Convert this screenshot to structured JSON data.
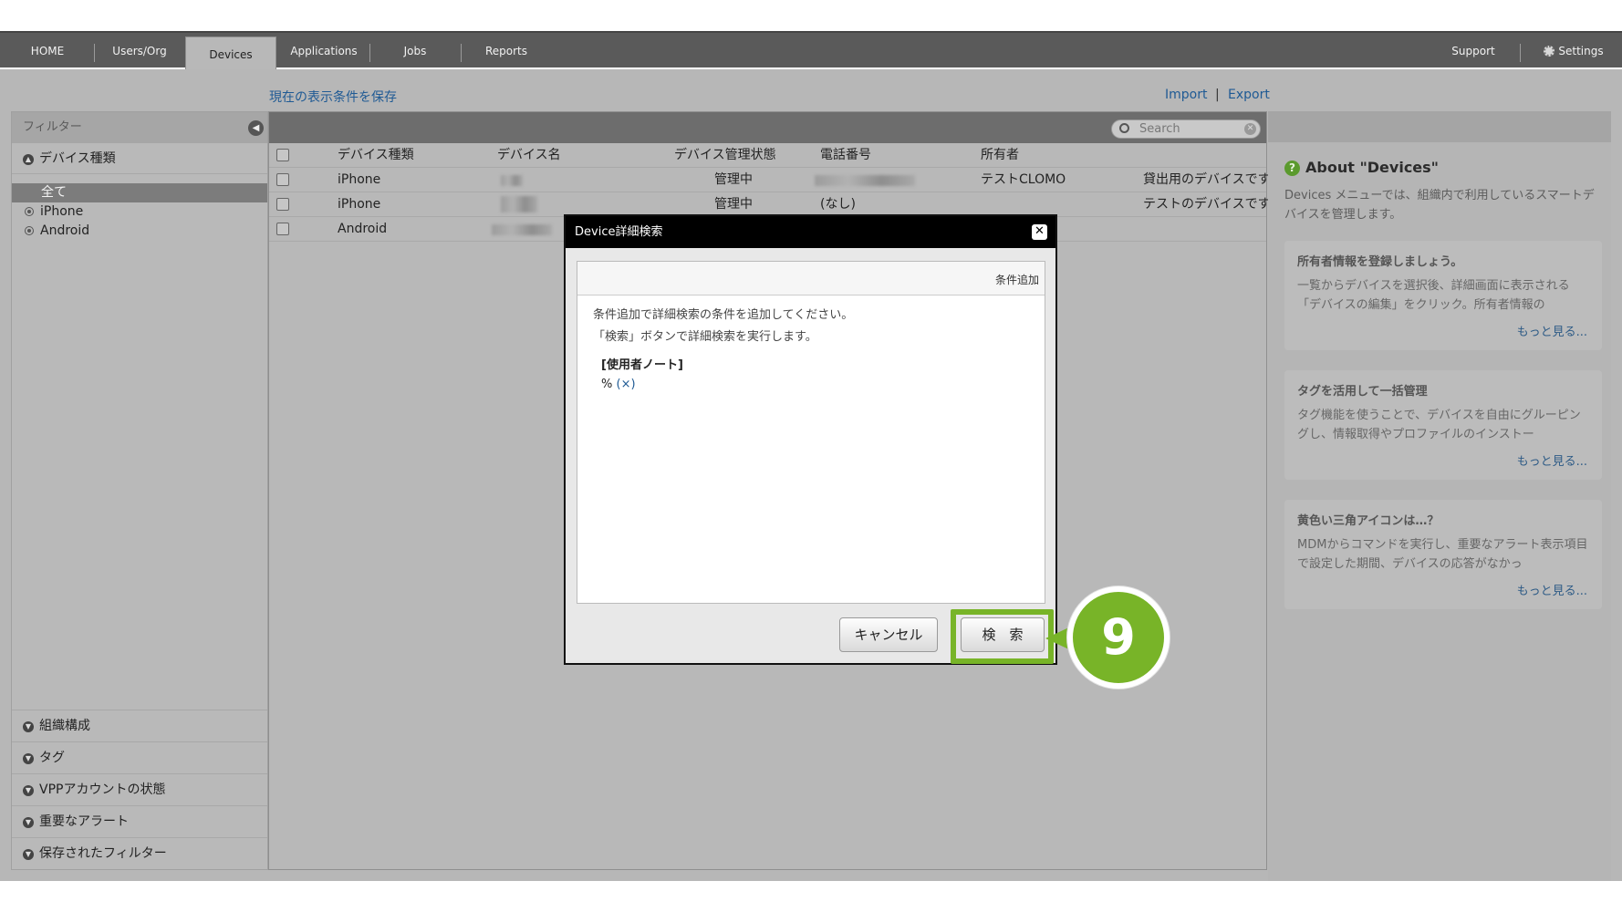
{
  "nav": {
    "home": "HOME",
    "users": "Users/Org",
    "devices": "Devices",
    "applications": "Applications",
    "jobs": "Jobs",
    "reports": "Reports",
    "support": "Support",
    "settings": "Settings"
  },
  "toolbar": {
    "save_view": "現在の表示条件を保存",
    "import": "Import",
    "separator": "|",
    "export": "Export"
  },
  "filter": {
    "title": "フィルター",
    "device_type": "デバイス種類",
    "items": [
      "全て",
      "iPhone",
      "Android"
    ],
    "sections": [
      "組織構成",
      "タグ",
      "VPPアカウントの状態",
      "重要なアラート",
      "保存されたフィルター"
    ]
  },
  "search": {
    "placeholder": "Search"
  },
  "table": {
    "headers": [
      "デバイス種類",
      "デバイス名",
      "デバイス管理状態",
      "電話番号",
      "所有者"
    ],
    "rows": [
      {
        "type": "iPhone",
        "status": "管理中",
        "phone": "",
        "owner": "テストCLOMO",
        "note": "貸出用のデバイスです"
      },
      {
        "type": "iPhone",
        "status": "管理中",
        "phone": "(なし)",
        "owner": "",
        "note": "テストのデバイスです"
      },
      {
        "type": "Android",
        "status": "",
        "phone": "",
        "owner": "",
        "note": ""
      }
    ]
  },
  "help": {
    "title": "About \"Devices\"",
    "description": "Devices メニューでは、組織内で利用しているスマートデバイスを管理します。",
    "cards": [
      {
        "title": "所有者情報を登録しましょう。",
        "body": "一覧からデバイスを選択後、詳細画面に表示される「デバイスの編集」をクリック。所有者情報の",
        "more": "もっと見る..."
      },
      {
        "title": "タグを活用して一括管理",
        "body": "タグ機能を使うことで、デバイスを自由にグルーピングし、情報取得やプロファイルのインストー",
        "more": "もっと見る..."
      },
      {
        "title": "黄色い三角アイコンは…？",
        "body": "MDMからコマンドを実行し、重要なアラート表示項目で設定した期間、デバイスの応答がなかっ",
        "more": "もっと見る..."
      }
    ]
  },
  "modal": {
    "title": "Device詳細検索",
    "add_condition": "条件追加",
    "line1": "条件追加で詳細検索の条件を追加してください。",
    "line2": "「検索」ボタンで詳細検索を実行します。",
    "condition_label": "[使用者ノート]",
    "condition_value": "% ",
    "condition_remove": "(×)",
    "cancel": "キャンセル",
    "search": "検　索"
  },
  "step_badge": "9",
  "colors": {
    "accent_green": "#78b428",
    "link_blue": "#1f5a94"
  }
}
